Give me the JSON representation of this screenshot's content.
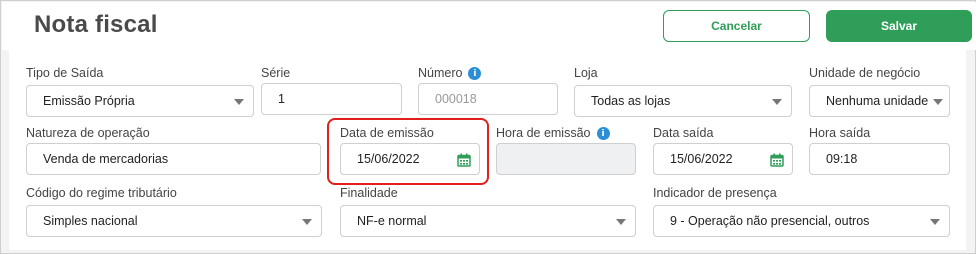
{
  "header": {
    "title": "Nota fiscal",
    "cancel_label": "Cancelar",
    "save_label": "Salvar"
  },
  "form": {
    "tipo_saida": {
      "label": "Tipo de Saída",
      "value": "Emissão Própria"
    },
    "serie": {
      "label": "Série",
      "value": "1"
    },
    "numero": {
      "label": "Número",
      "placeholder": "000018"
    },
    "loja": {
      "label": "Loja",
      "value": "Todas as lojas"
    },
    "unidade_negocio": {
      "label": "Unidade de negócio",
      "value": "Nenhuma unidade"
    },
    "natureza_operacao": {
      "label": "Natureza de operação",
      "value": "Venda de mercadorias"
    },
    "data_emissao": {
      "label": "Data de emissão",
      "value": "15/06/2022"
    },
    "hora_emissao": {
      "label": "Hora de emissão",
      "value": ""
    },
    "data_saida": {
      "label": "Data saída",
      "value": "15/06/2022"
    },
    "hora_saida": {
      "label": "Hora saída",
      "value": "09:18"
    },
    "regime_tributario": {
      "label": "Código do regime tributário",
      "value": "Simples nacional"
    },
    "finalidade": {
      "label": "Finalidade",
      "value": "NF-e normal"
    },
    "indicador_presenca": {
      "label": "Indicador de presença",
      "value": "9 - Operação não presencial, outros"
    }
  },
  "icons": {
    "info": "info-icon",
    "calendar": "calendar-icon",
    "dropdown": "chevron-down-icon"
  },
  "colors": {
    "accent": "#2e9e58",
    "info": "#2a8fd6",
    "highlight": "#e0201c"
  }
}
